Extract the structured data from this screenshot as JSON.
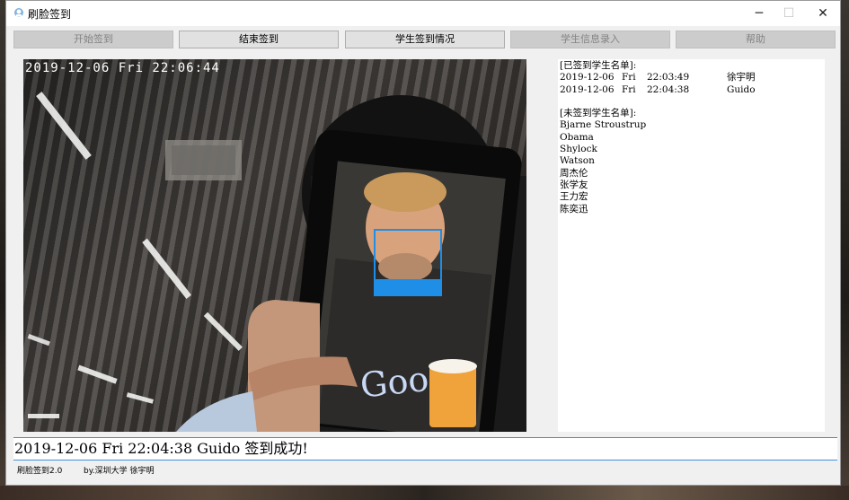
{
  "window": {
    "title": "刷脸签到",
    "minimize": "─",
    "maximize": "☐",
    "close": "✕"
  },
  "toolbar": [
    {
      "label": "开始签到",
      "enabled": false
    },
    {
      "label": "结束签到",
      "enabled": true
    },
    {
      "label": "学生签到情况",
      "enabled": true
    },
    {
      "label": "学生信息录入",
      "enabled": false
    },
    {
      "label": "帮助",
      "enabled": false
    }
  ],
  "video": {
    "timestamp": "2019-12-06   Fri   22:06:44",
    "shirt_logo": "Goog",
    "face_box_color": "#1e8ee6"
  },
  "attendance": {
    "signed_header": "[已签到学生名单]:",
    "signed": [
      {
        "date": "2019-12-06",
        "day": "Fri",
        "time": "22:03:49",
        "name": "徐宇明"
      },
      {
        "date": "2019-12-06",
        "day": "Fri",
        "time": "22:04:38",
        "name": "Guido"
      }
    ],
    "unsigned_header": "[未签到学生名单]:",
    "unsigned": [
      "Bjarne Stroustrup",
      "Obama",
      "Shylock",
      "Watson",
      "周杰伦",
      "张学友",
      "王力宏",
      "陈奕迅"
    ]
  },
  "status": {
    "message": "2019-12-06  Fri  22:04:38  Guido  签到成功!"
  },
  "footer": {
    "version": "刷脸签到2.0",
    "author": "by.深圳大学 徐宇明"
  },
  "colors": {
    "accent_line": "#3b8fd8",
    "disabled_button": "#cccccc",
    "enabled_button": "#e1e1e1"
  }
}
